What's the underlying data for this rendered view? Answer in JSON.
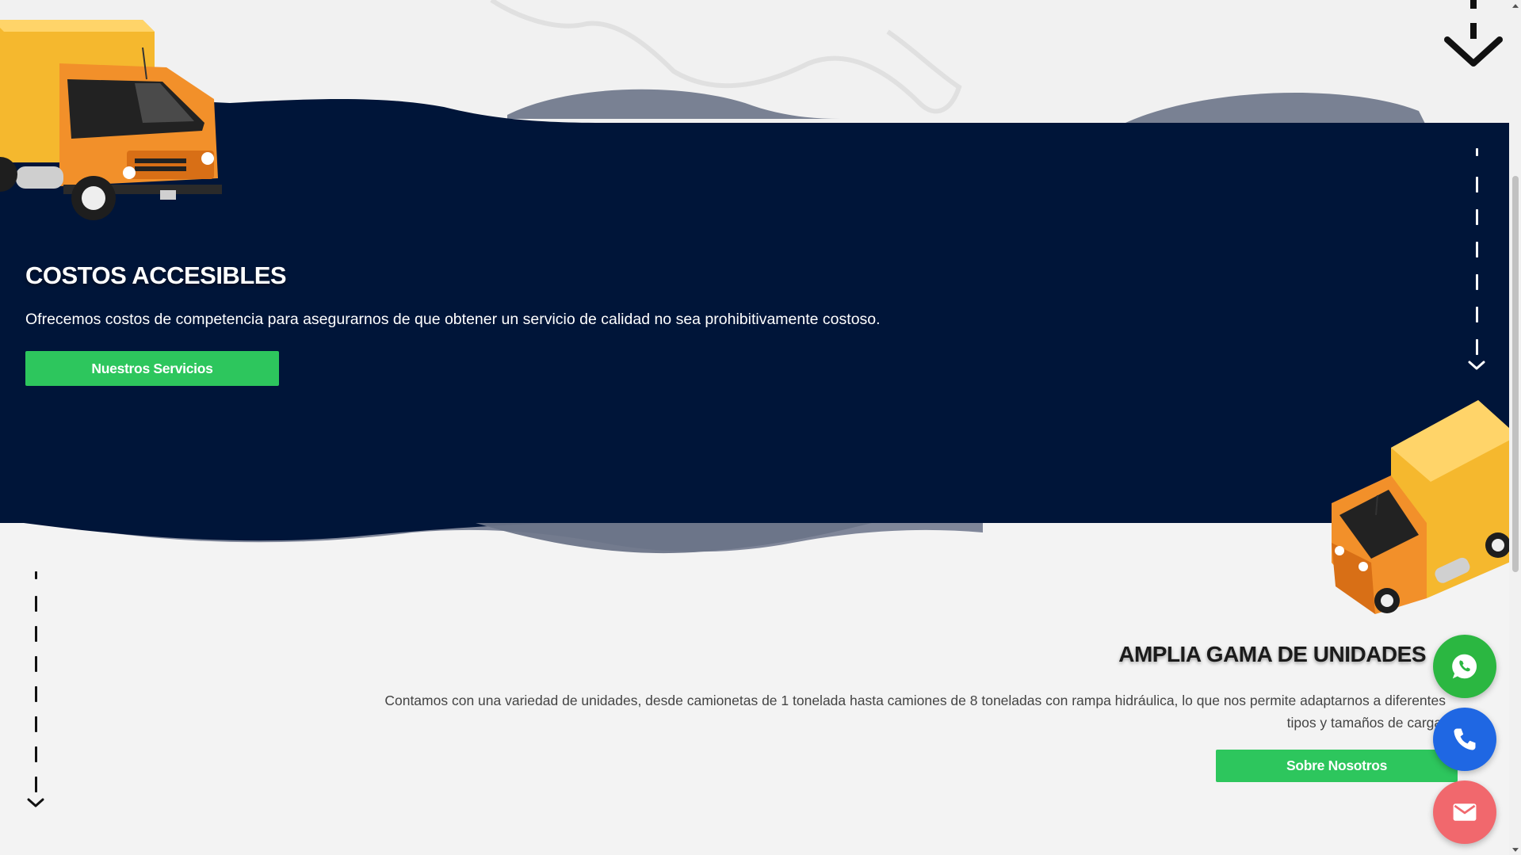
{
  "section_costs": {
    "title": "COSTOS ACCESIBLES",
    "description": "Ofrecemos costos de competencia para asegurarnos de que obtener un servicio de calidad no sea prohibitivamente costoso.",
    "button_label": "Nuestros Servicios"
  },
  "section_units": {
    "title": "AMPLIA GAMA DE UNIDADES",
    "description": "Contamos con una variedad de unidades, desde camionetas de 1 tonelada hasta camiones de 8 toneladas con rampa hidráulica, lo que nos permite adaptarnos a diferentes tipos y tamaños de carga.",
    "button_label": "Sobre Nosotros"
  },
  "floating_buttons": [
    {
      "icon": "whatsapp-icon",
      "color": "#2bb741"
    },
    {
      "icon": "phone-icon",
      "color": "#1f67e3"
    },
    {
      "icon": "mail-icon",
      "color": "#f1686d"
    }
  ],
  "colors": {
    "navy_band": "#001539",
    "accent_green": "#2dc65d",
    "truck_orange": "#f2902a",
    "truck_yellow": "#f5b82e"
  }
}
